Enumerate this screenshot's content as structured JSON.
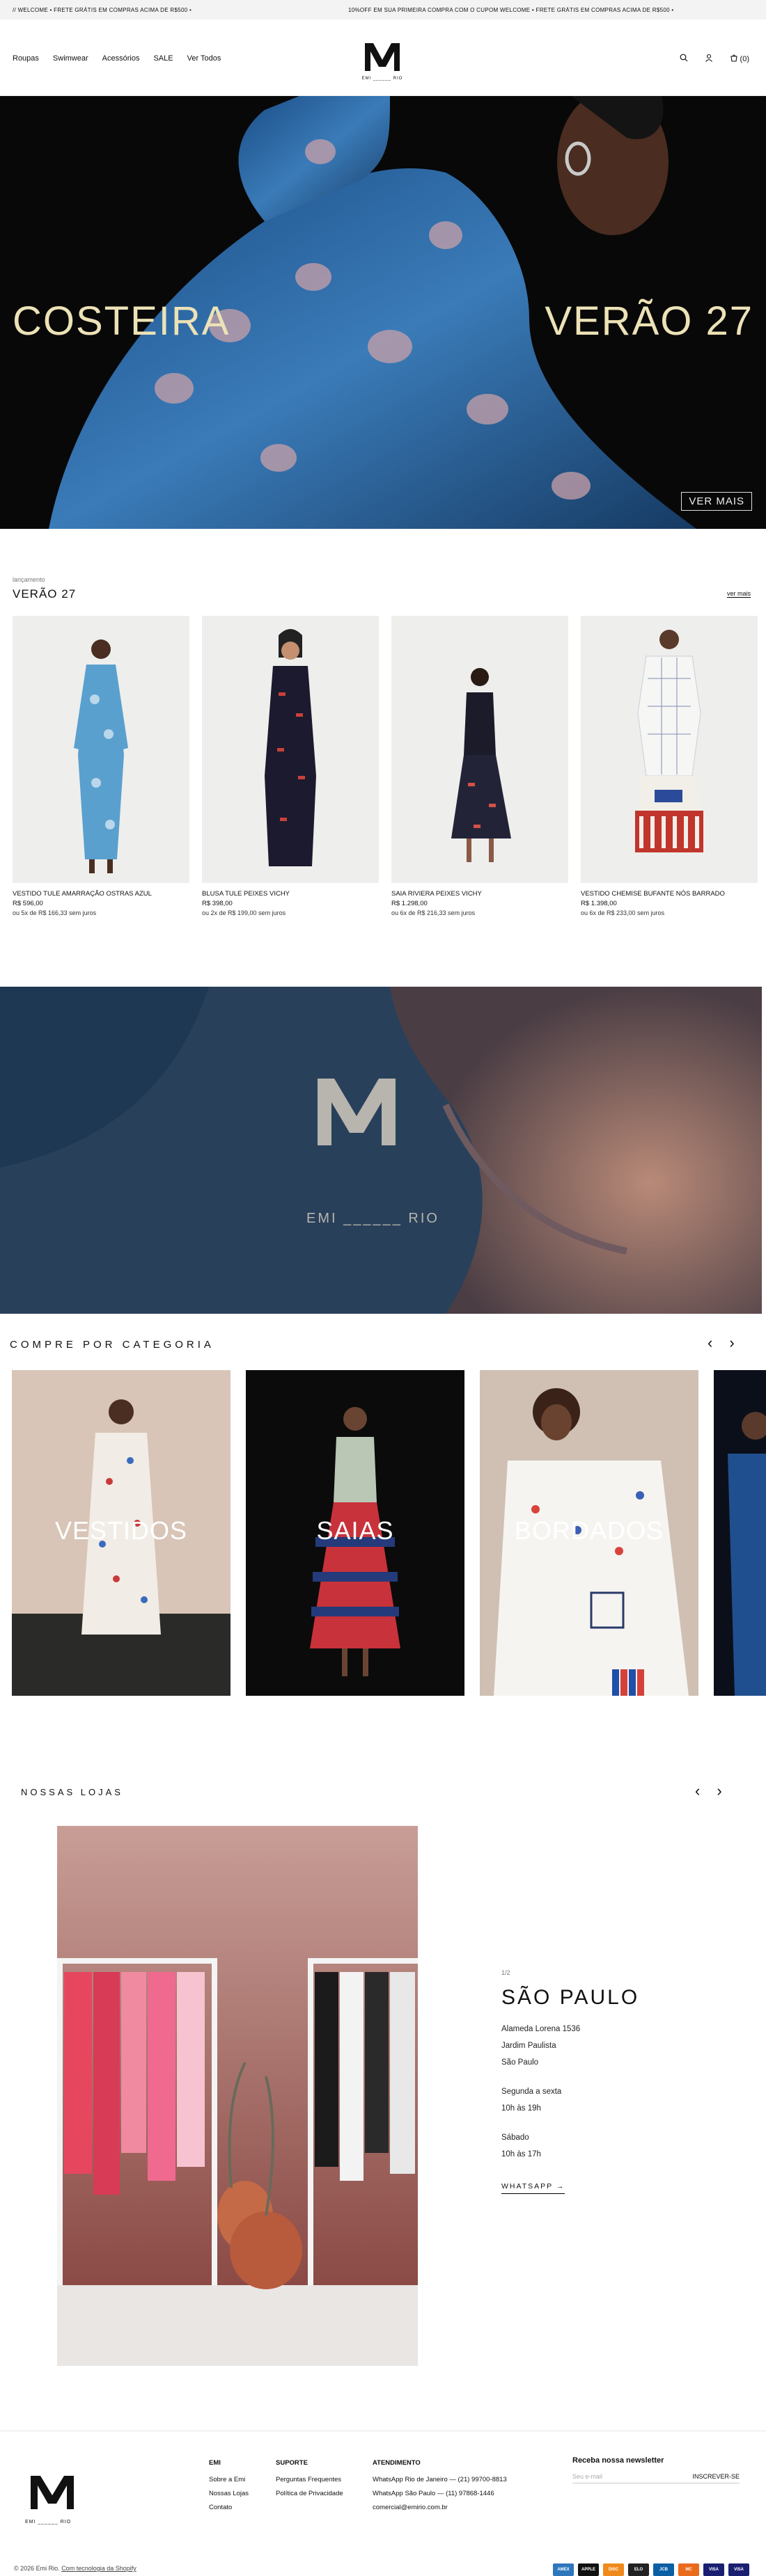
{
  "announcement": {
    "item_left": "// WELCOME • FRETE GRÁTIS EM COMPRAS ACIMA DE R$500 •",
    "item_right": "10%OFF EM SUA PRIMEIRA COMPRA COM O CUPOM WELCOME • FRETE GRÁTIS EM COMPRAS ACIMA DE R$500 •"
  },
  "header": {
    "nav": [
      "Roupas",
      "Swimwear",
      "Acessórios",
      "SALE",
      "Ver Todos"
    ],
    "logo_text": "EMI ______ RIO",
    "cart_label": "(0)"
  },
  "hero": {
    "left_title": "COSTEIRA",
    "right_title": "VERÃO 27",
    "button": "VER MAIS"
  },
  "collection": {
    "eyebrow": "lançamento",
    "title": "VERÃO 27",
    "view_all": "ver mais",
    "products": [
      {
        "name": "VESTIDO TULE AMARRAÇÃO OSTRAS AZUL",
        "price": "R$ 596,00",
        "installments": "ou 5x de R$ 166,33 sem juros"
      },
      {
        "name": "BLUSA TULE PEIXES VICHY",
        "price": "R$ 398,00",
        "installments": "ou 2x de R$ 199,00 sem juros"
      },
      {
        "name": "SAIA RIVIERA PEIXES VICHY",
        "price": "R$ 1.298,00",
        "installments": "ou 6x de R$ 216,33 sem juros"
      },
      {
        "name": "VESTIDO CHEMISE BUFANTE NÓS BARRADO",
        "price": "R$ 1.398,00",
        "installments": "ou 6x de R$ 233,00 sem juros"
      }
    ]
  },
  "brand_banner": {
    "logo_text": "EMI ______ RIO"
  },
  "categories": {
    "title": "COMPRE POR CATEGORIA",
    "items": [
      "VESTIDOS",
      "SAIAS",
      "BORDADOS"
    ]
  },
  "stores": {
    "title": "NOSSAS LOJAS",
    "counter": "1/2",
    "city": "SÃO PAULO",
    "address": [
      "Alameda Lorena 1536",
      "Jardim Paulista",
      "São Paulo"
    ],
    "weekdays": [
      "Segunda a sexta",
      "10h às 19h"
    ],
    "saturday": [
      "Sábado",
      "10h às 17h"
    ],
    "whatsapp": "WHATSAPP →"
  },
  "footer": {
    "logo_text": "EMI ______ RIO",
    "emi": {
      "heading": "EMI",
      "links": [
        "Sobre a Emi",
        "Nossas Lojas",
        "Contato"
      ]
    },
    "suporte": {
      "heading": "SUPORTE",
      "links": [
        "Perguntas Frequentes",
        "Política de Privacidade"
      ]
    },
    "atendimento": {
      "heading": "ATENDIMENTO",
      "links": [
        "WhatsApp Rio de Janeiro — (21) 99700-8813",
        "WhatsApp São Paulo — (11) 97868-1446",
        "comercial@emirio.com.br"
      ]
    },
    "newsletter": {
      "heading": "Receba nossa newsletter",
      "placeholder": "Seu e-mail",
      "button": "INSCREVER-SE"
    },
    "copyright": "© 2026 Emi Rio.",
    "powered": "Com tecnologia da Shopify",
    "payments": [
      "AMEX",
      "APPLE",
      "DISC",
      "ELO",
      "JCB",
      "MC",
      "VISA",
      "VISA"
    ]
  }
}
